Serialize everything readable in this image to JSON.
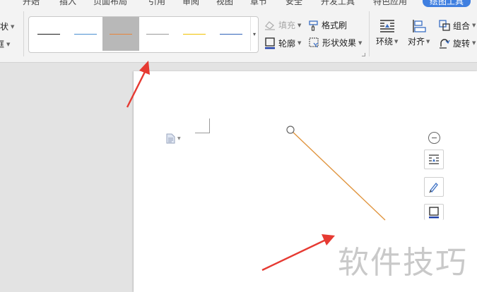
{
  "ribbon": {
    "tabs": [
      {
        "label": "开始"
      },
      {
        "label": "插入"
      },
      {
        "label": "页面布局"
      },
      {
        "label": "引用"
      },
      {
        "label": "审阅"
      },
      {
        "label": "视图"
      },
      {
        "label": "章节"
      },
      {
        "label": "安全"
      },
      {
        "label": "开发工具"
      },
      {
        "label": "特色应用"
      },
      {
        "label": "绘图工具",
        "active": true
      }
    ],
    "left_partial": {
      "shape_label": "形状",
      "partial_label": "框"
    },
    "line_styles": [
      {
        "color": "#1a1a1a",
        "selected": false
      },
      {
        "color": "#4a8fd0",
        "selected": false
      },
      {
        "color": "#e8853a",
        "selected": true
      },
      {
        "color": "#9a9a9a",
        "selected": false
      },
      {
        "color": "#f2c200",
        "selected": false
      },
      {
        "color": "#2f62b8",
        "selected": false
      }
    ],
    "fill_label": "填充",
    "format_painter_label": "格式刷",
    "outline_label": "轮廓",
    "shape_effects_label": "形状效果",
    "wrap_label": "环绕",
    "align_label": "对齐",
    "group_label": "组合",
    "rotate_label": "旋转"
  },
  "document": {
    "line_color": "#e0953f",
    "watermark": "软件技巧"
  },
  "colors": {
    "accent": "#3f7fe0",
    "arrow": "#e63a32"
  }
}
